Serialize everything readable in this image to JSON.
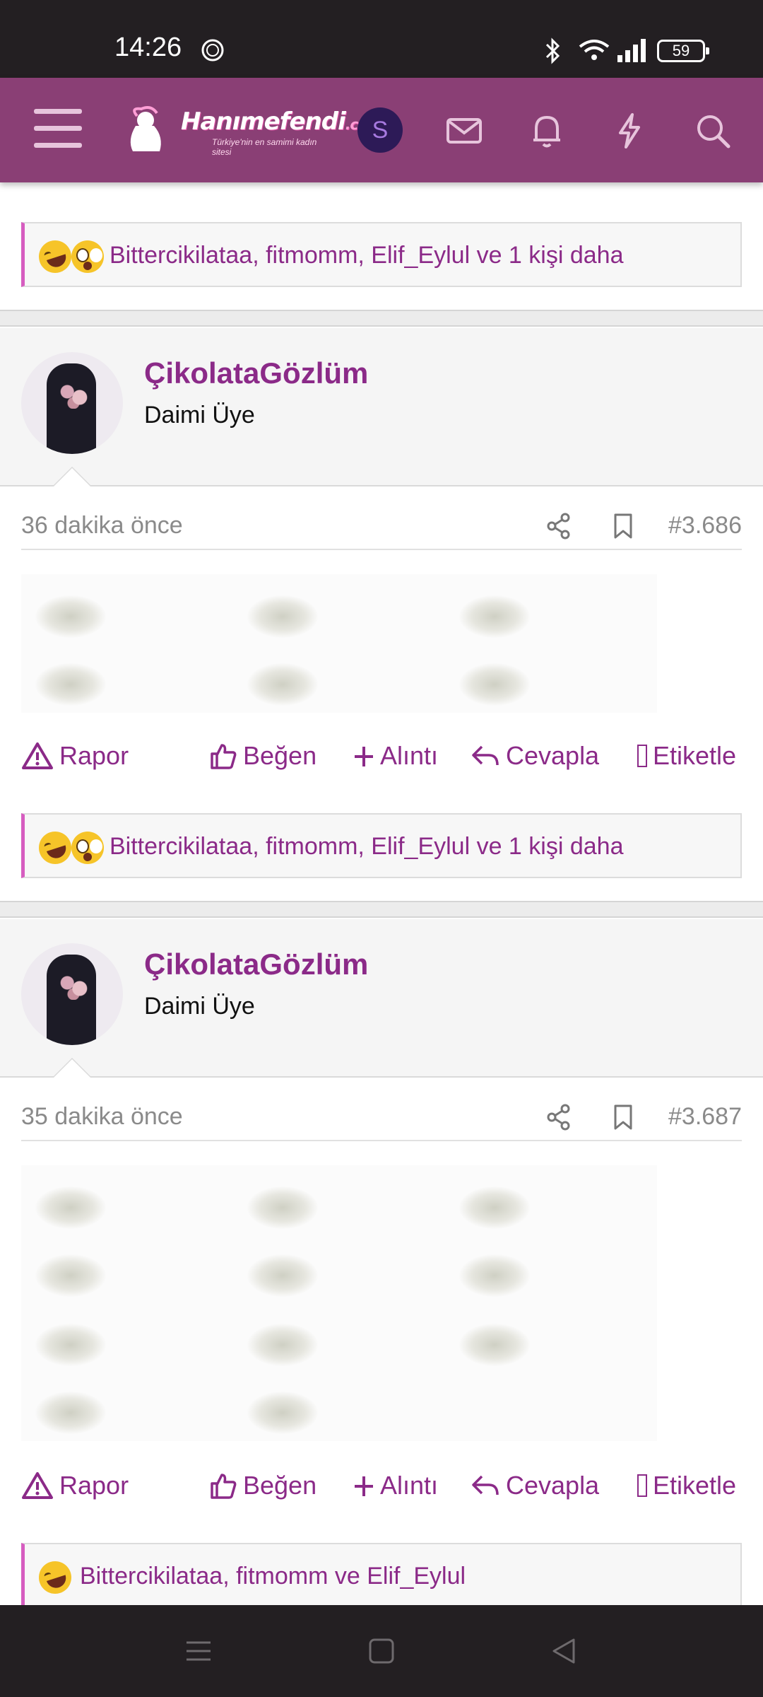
{
  "status_bar": {
    "time": "14:26",
    "battery": "59",
    "icons": [
      "alarm-icon",
      "bluetooth-icon",
      "wifi-icon",
      "signal-icon",
      "battery-icon"
    ]
  },
  "header": {
    "logo_text": "Hanımefendi",
    "logo_suffix": ".com",
    "logo_tagline": "Türkiye'nin en samimi kadın sitesi",
    "avatar_initial": "S",
    "colors": {
      "bar": "#8a3f75",
      "avatar_bg": "#2d1a57",
      "accent": "#8b2a88"
    },
    "icons": [
      "menu-icon",
      "mail-icon",
      "bell-icon",
      "bolt-icon",
      "search-icon"
    ]
  },
  "posts": [
    {
      "reactions": {
        "emojis": [
          "laughing-emoji",
          "shocked-emoji"
        ],
        "text": "Bittercikilataa, fitmomm, Elif_Eylul ve 1 kişi daha"
      }
    },
    {
      "author": "ÇikolataGözlüm",
      "role": "Daimi Üye",
      "time": "36 dakika önce",
      "number": "#3.686",
      "actions": {
        "report": "Rapor",
        "like": "Beğen",
        "quote": "Alıntı",
        "reply": "Cevapla",
        "tag": "Etiketle"
      },
      "reactions": {
        "emojis": [
          "laughing-emoji",
          "shocked-emoji"
        ],
        "text": "Bittercikilataa, fitmomm, Elif_Eylul ve 1 kişi daha"
      }
    },
    {
      "author": "ÇikolataGözlüm",
      "role": "Daimi Üye",
      "time": "35 dakika önce",
      "number": "#3.687",
      "actions": {
        "report": "Rapor",
        "like": "Beğen",
        "quote": "Alıntı",
        "reply": "Cevapla",
        "tag": "Etiketle"
      },
      "reactions": {
        "emojis": [
          "laughing-emoji"
        ],
        "text": "Bittercikilataa, fitmomm ve Elif_Eylul"
      }
    }
  ],
  "nav_bar": {
    "icons": [
      "recent-apps-icon",
      "home-icon",
      "back-icon"
    ]
  }
}
